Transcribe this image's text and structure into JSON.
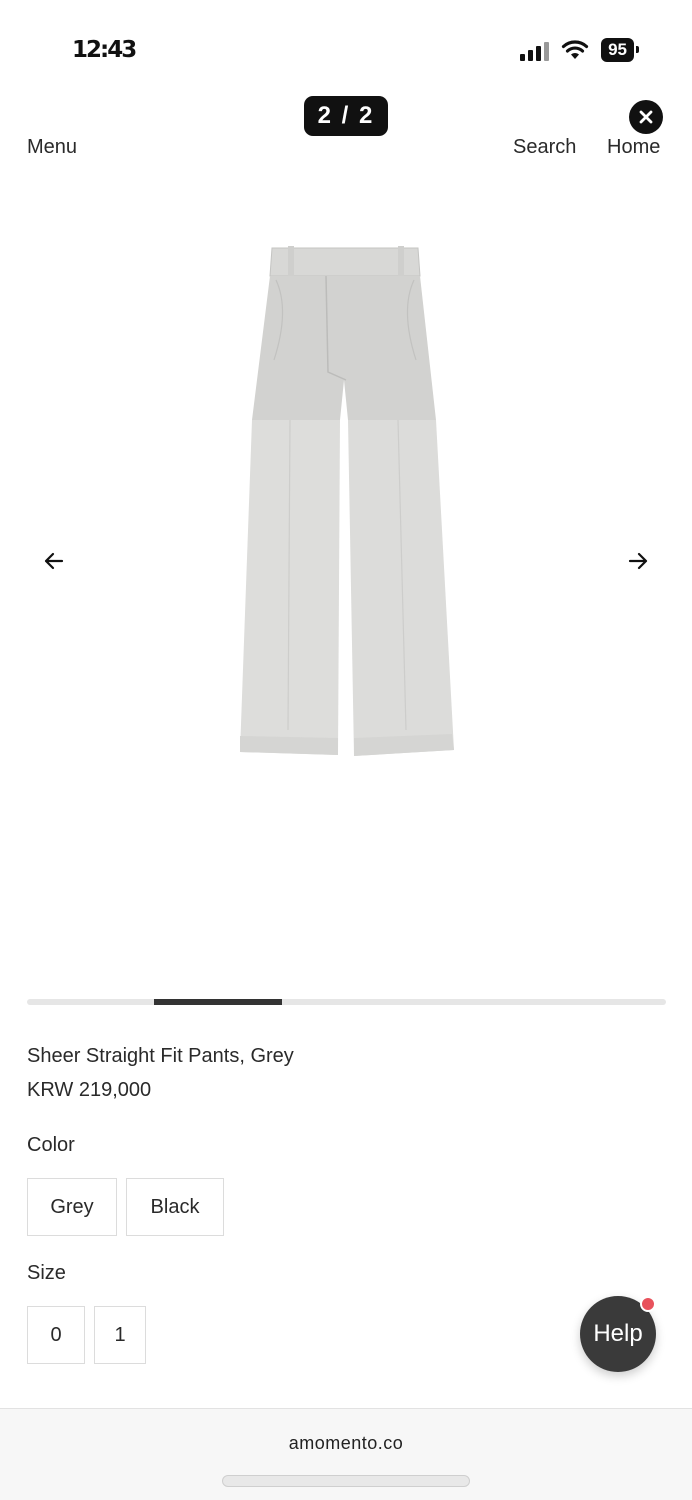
{
  "status_bar": {
    "time": "12:43",
    "battery": "95"
  },
  "viewer": {
    "page_counter": "2 / 2"
  },
  "nav": {
    "menu": "Menu",
    "search": "Search",
    "home": "Home"
  },
  "carousel": {
    "progress": 0.2
  },
  "product": {
    "name": "Sheer Straight Fit Pants, Grey",
    "price": "KRW 219,000",
    "color_label": "Color",
    "color_options": [
      "Grey",
      "Black"
    ],
    "size_label": "Size",
    "size_options": [
      "0",
      "1"
    ]
  },
  "help": {
    "label": "Help"
  },
  "browser": {
    "url": "amomento.co"
  },
  "colors": {
    "accent_dark": "#111111",
    "notification": "#e8525c",
    "pants": "#d3d3d1"
  }
}
